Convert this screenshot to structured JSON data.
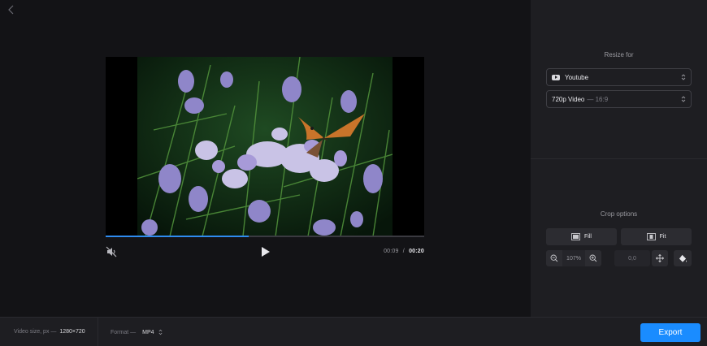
{
  "player": {
    "current_time": "00:09",
    "separator": "/",
    "total_time": "00:20",
    "progress_fraction": 0.45
  },
  "resize": {
    "heading": "Resize for",
    "platform": "Youtube",
    "preset_name": "720p Video",
    "preset_ratio": "— 16:9"
  },
  "crop": {
    "heading": "Crop options",
    "fill_label": "Fill",
    "fit_label": "Fit",
    "zoom_value": "107%",
    "position_value": "0,0"
  },
  "footer": {
    "size_label": "Video size, px —",
    "size_value": "1280×720",
    "format_label": "Format —",
    "format_value": "MP4",
    "export_label": "Export"
  },
  "icons": {
    "back": "chevron-left-icon",
    "mute": "muted-speaker-icon",
    "play": "play-icon",
    "platform": "youtube-icon",
    "fill": "fill-icon",
    "fit": "fit-icon",
    "zoom_out": "zoom-out-icon",
    "zoom_in": "zoom-in-icon",
    "move": "move-arrows-icon",
    "background_fill": "paint-bucket-icon"
  },
  "colors": {
    "accent": "#1a8cff",
    "progress": "#2f8cf0",
    "panel": "#1e1e22",
    "background": "#131316"
  }
}
